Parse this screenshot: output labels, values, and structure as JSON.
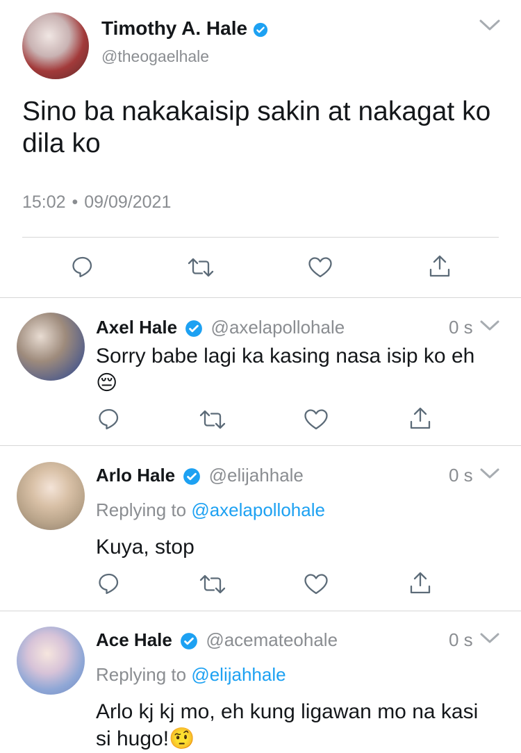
{
  "main_tweet": {
    "display_name": "Timothy A. Hale",
    "handle": "@theogaelhale",
    "text": "Sino ba nakakaisip sakin at nakagat ko dila ko",
    "time": "15:02",
    "date": "09/09/2021",
    "separator": "•"
  },
  "replies": [
    {
      "display_name": "Axel Hale",
      "handle": "@axelapollohale",
      "time": "0 s",
      "text": "Sorry babe lagi ka kasing nasa isip ko eh",
      "emoji": "😔"
    },
    {
      "display_name": "Arlo Hale",
      "handle": "@elijahhale",
      "time": "0 s",
      "replying_prefix": "Replying to",
      "replying_to": "@axelapollohale",
      "text": "Kuya, stop"
    },
    {
      "display_name": "Ace Hale",
      "handle": "@acemateohale",
      "time": "0 s",
      "replying_prefix": "Replying to",
      "replying_to": "@elijahhale",
      "text": "Arlo kj kj mo, eh kung ligawan mo na kasi si hugo!",
      "emoji": "🤨"
    }
  ],
  "icons": {
    "reply": "reply-icon",
    "retweet": "retweet-icon",
    "like": "heart-icon",
    "share": "share-icon",
    "more": "chevron-down-icon",
    "verified": "verified-badge-icon"
  },
  "colors": {
    "accent": "#1da1f2",
    "muted": "#8a8d91",
    "text": "#14171a"
  }
}
